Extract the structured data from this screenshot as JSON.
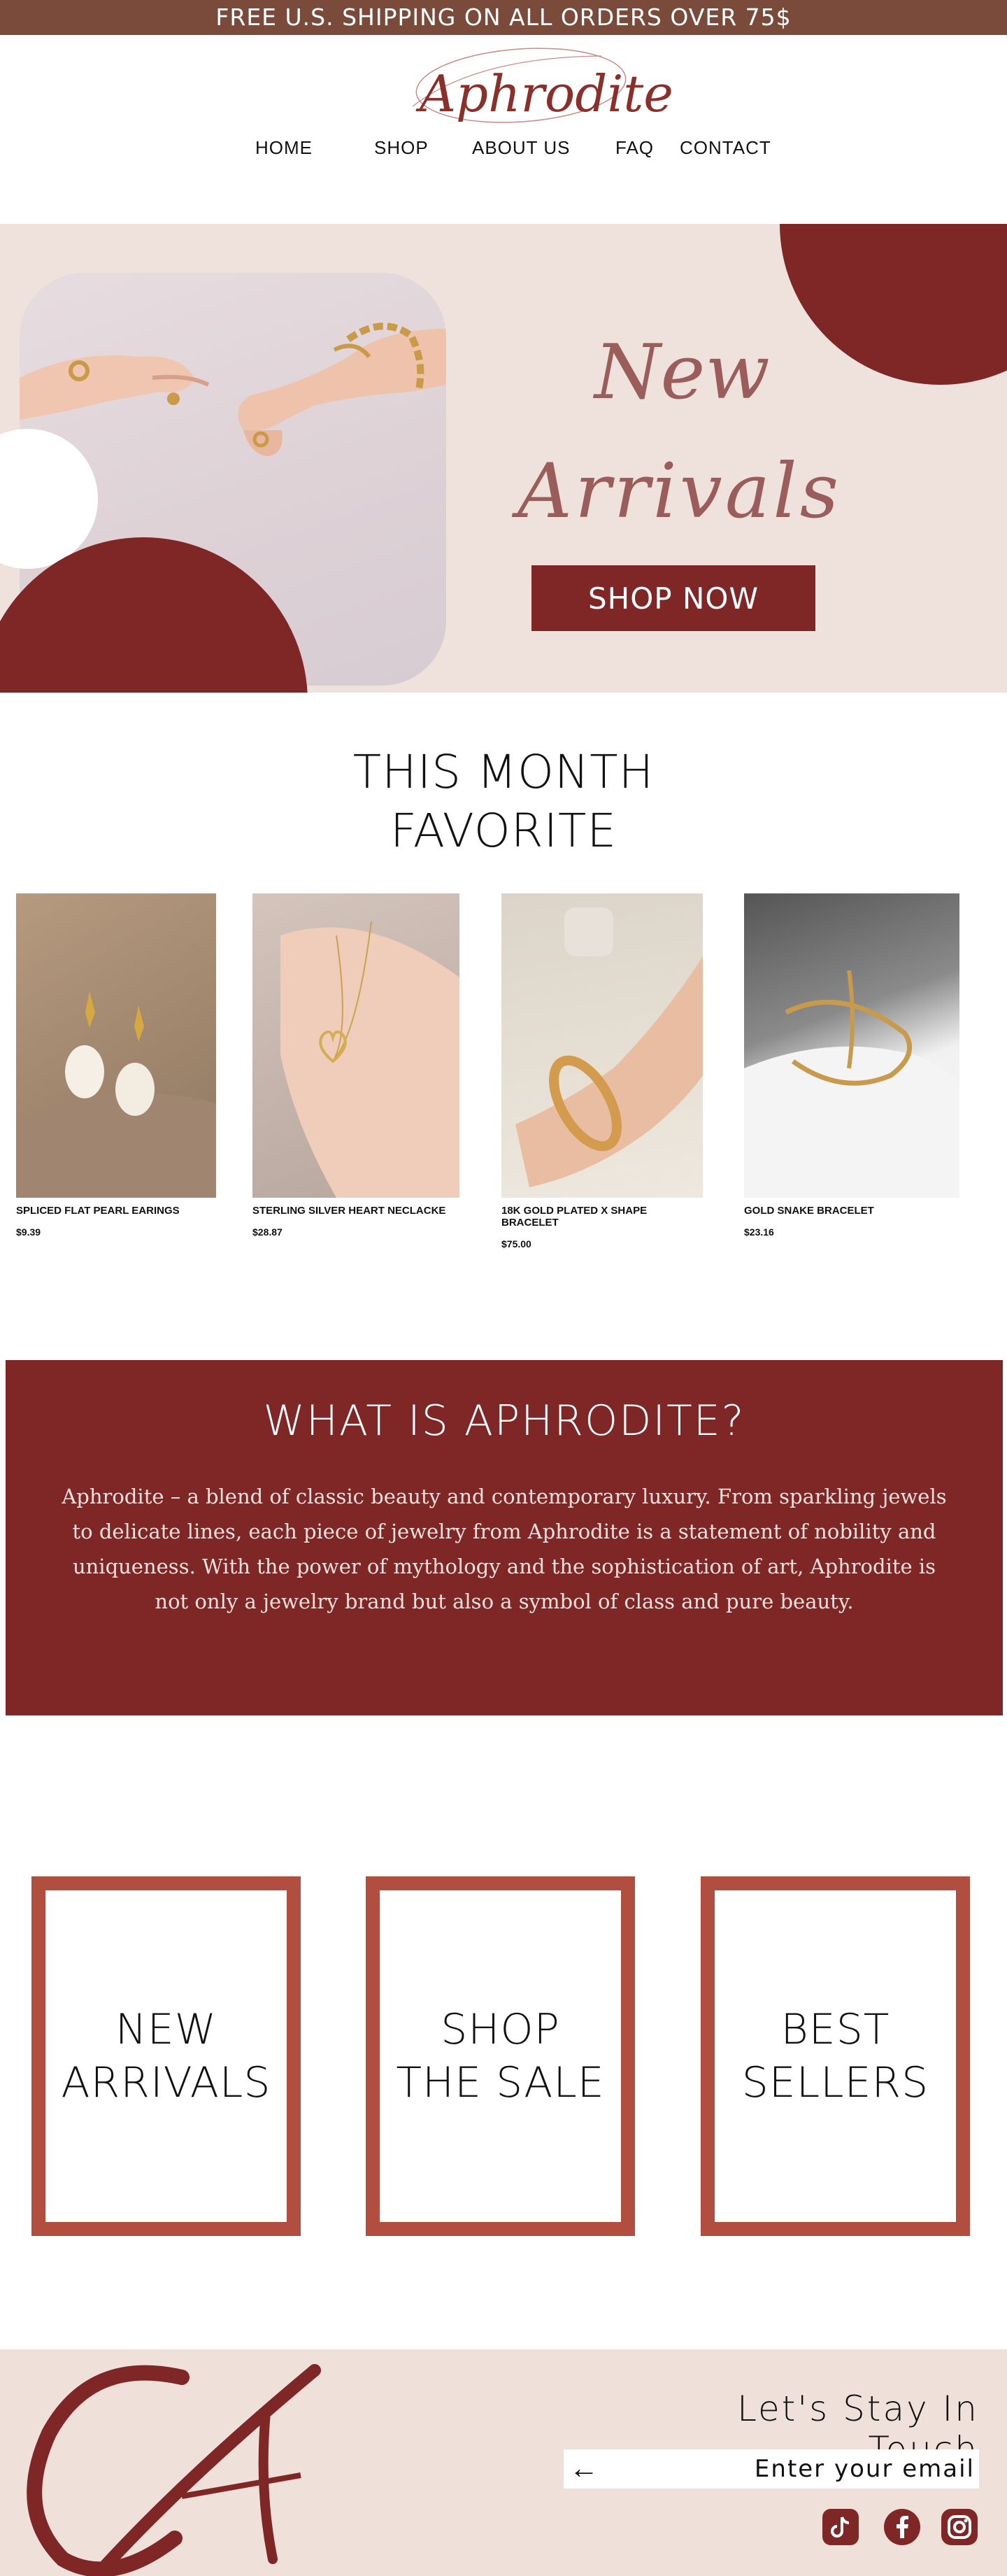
{
  "banner": {
    "text": "FREE U.S. SHIPPING ON ALL ORDERS OVER 75$"
  },
  "brand": {
    "name": "Aphrodite"
  },
  "nav": [
    {
      "label": "HOME"
    },
    {
      "label": "SHOP"
    },
    {
      "label": "ABOUT US"
    },
    {
      "label": "FAQ"
    },
    {
      "label": "CONTACT"
    }
  ],
  "hero": {
    "title_line1": "New",
    "title_line2": "Arrivals",
    "cta": "SHOP NOW"
  },
  "favorites": {
    "title_line1": "THIS MONTH",
    "title_line2": "FAVORITE",
    "products": [
      {
        "name": "SPLICED FLAT PEARL EARINGS",
        "price": "$9.39"
      },
      {
        "name": "STERLING SILVER HEART NECLACKE",
        "price": "$28.87"
      },
      {
        "name": "18K GOLD PLATED X SHAPE BRACELET",
        "price": "$75.00"
      },
      {
        "name": "GOLD SNAKE BRACELET",
        "price": "$23.16"
      }
    ]
  },
  "about": {
    "title": "WHAT IS APHRODITE?",
    "body": "Aphrodite – a blend of classic beauty and contemporary luxury. From sparkling jewels to delicate lines, each piece of jewelry from Aphrodite is a statement of nobility and uniqueness. With the power of mythology and the sophistication of art, Aphrodite is not only a jewelry brand but also a symbol of class and pure beauty."
  },
  "categories": [
    {
      "label": "NEW\nARRIVALS"
    },
    {
      "label": "SHOP\nTHE SALE"
    },
    {
      "label": "BEST\nSELLERS"
    }
  ],
  "footer": {
    "title": "Let's Stay In Touch",
    "email_placeholder": "Enter your email",
    "socials": [
      "tiktok-icon",
      "facebook-icon",
      "instagram-icon"
    ]
  },
  "colors": {
    "banner": "#7a4b3a",
    "brand_red": "#7f2626",
    "card_border": "#b14e3f",
    "hero_bg": "#efe2dc",
    "hero_script": "#9b5d5b"
  }
}
